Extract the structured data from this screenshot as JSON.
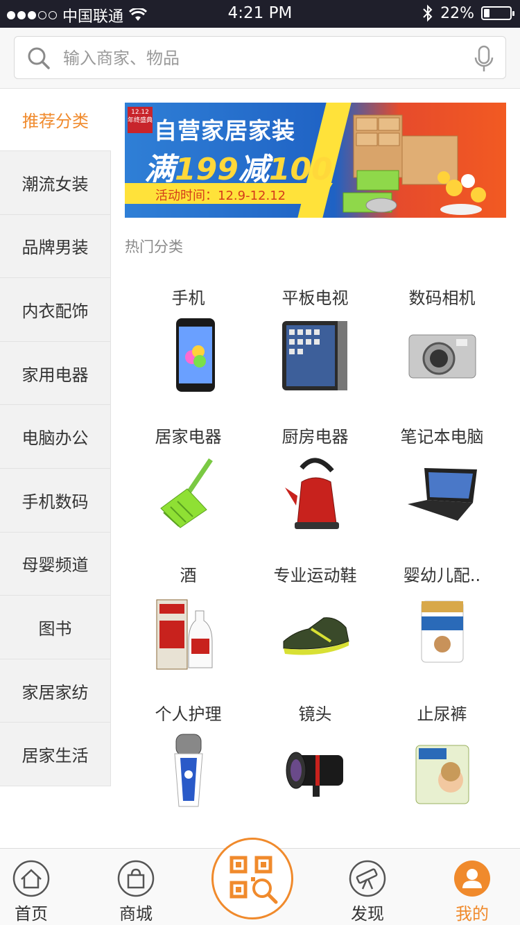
{
  "status_bar": {
    "carrier": "中国联通",
    "time": "4:21 PM",
    "battery": "22%",
    "battery_level": 0.22
  },
  "search": {
    "placeholder": "输入商家、物品"
  },
  "sidebar": {
    "items": [
      {
        "label": "推荐分类",
        "active": true
      },
      {
        "label": "潮流女装"
      },
      {
        "label": "品牌男装"
      },
      {
        "label": "内衣配饰"
      },
      {
        "label": "家用电器"
      },
      {
        "label": "电脑办公"
      },
      {
        "label": "手机数码"
      },
      {
        "label": "母婴频道"
      },
      {
        "label": "图书"
      },
      {
        "label": "家居家纺"
      },
      {
        "label": "居家生活"
      }
    ]
  },
  "banner": {
    "badge": "12.12 年终盛典",
    "title": "自营家居家装",
    "promo_prefix": "满",
    "promo_num1": "199",
    "promo_mid": "减",
    "promo_num2": "100",
    "date": "活动时间：12.9-12.12"
  },
  "hot": {
    "title": "热门分类",
    "items": [
      {
        "label": "手机",
        "icon": "smartphone-icon"
      },
      {
        "label": "平板电视",
        "icon": "tablet-icon"
      },
      {
        "label": "数码相机",
        "icon": "camera-icon"
      },
      {
        "label": "居家电器",
        "icon": "broom-icon"
      },
      {
        "label": "厨房电器",
        "icon": "kettle-icon"
      },
      {
        "label": "笔记本电脑",
        "icon": "laptop-icon"
      },
      {
        "label": "酒",
        "icon": "liquor-icon"
      },
      {
        "label": "专业运动鞋",
        "icon": "sneaker-icon"
      },
      {
        "label": "婴幼儿配..",
        "icon": "milk-powder-icon"
      },
      {
        "label": "个人护理",
        "icon": "shaver-icon"
      },
      {
        "label": "镜头",
        "icon": "lens-icon"
      },
      {
        "label": "止尿裤",
        "icon": "diaper-icon"
      }
    ]
  },
  "nav": {
    "home": "首页",
    "mall": "商城",
    "discover": "发现",
    "mine": "我的"
  },
  "colors": {
    "accent": "#f08a2c",
    "status_bar": "#1f1f2b"
  }
}
